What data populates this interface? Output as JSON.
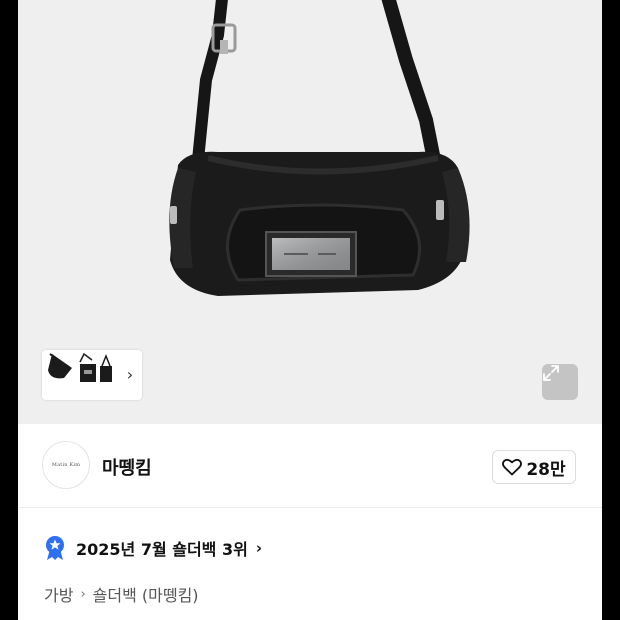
{
  "product": {
    "image_icon": "shoulder-bag-photo",
    "thumbnail_icon": "bag-thumbnails",
    "chevron_icon": "chevron-right-icon",
    "expand_icon": "expand-arrows-icon"
  },
  "store": {
    "logo_text": "Matin Kim",
    "name": "마뗑킴",
    "like_icon": "heart-outline-icon",
    "like_count": "28만"
  },
  "ranking": {
    "badge_icon": "award-ribbon-icon",
    "badge_color": "#2f6ff2",
    "text": "2025년 7월 숄더백 3위",
    "chevron": "›"
  },
  "breadcrumb": {
    "items": [
      "가방",
      "숄더백 (마뗑킴)"
    ],
    "separator": "›"
  }
}
